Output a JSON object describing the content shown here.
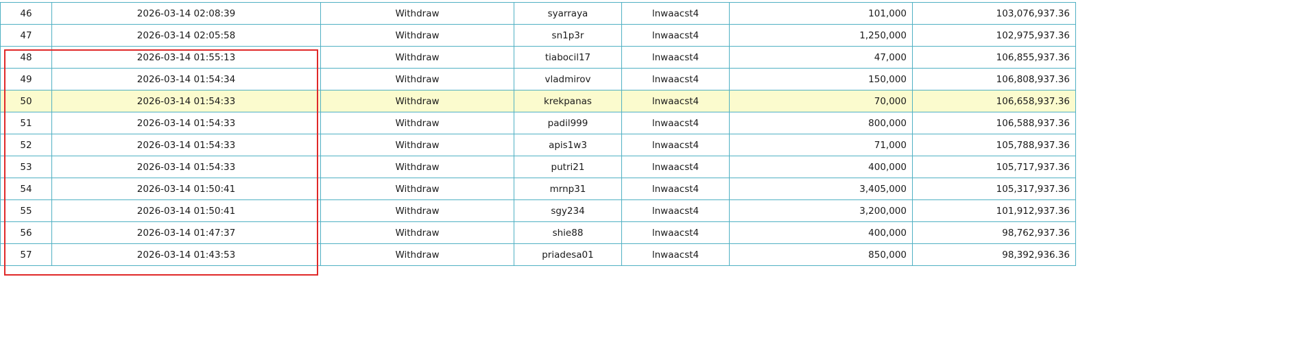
{
  "colors": {
    "grid_border": "#4fb0c3",
    "highlight_row": "#fbfbce",
    "selection_box": "#e02828"
  },
  "highlighted_row_no": "50",
  "rows": [
    {
      "no": "46",
      "datetime": "2026-03-14 02:08:39",
      "type": "Withdraw",
      "username": "syarraya",
      "operator": "lnwaacst4",
      "amount": "101,000",
      "balance": "103,076,937.36"
    },
    {
      "no": "47",
      "datetime": "2026-03-14 02:05:58",
      "type": "Withdraw",
      "username": "sn1p3r",
      "operator": "lnwaacst4",
      "amount": "1,250,000",
      "balance": "102,975,937.36"
    },
    {
      "no": "48",
      "datetime": "2026-03-14 01:55:13",
      "type": "Withdraw",
      "username": "tiabocil17",
      "operator": "lnwaacst4",
      "amount": "47,000",
      "balance": "106,855,937.36"
    },
    {
      "no": "49",
      "datetime": "2026-03-14 01:54:34",
      "type": "Withdraw",
      "username": "vladmirov",
      "operator": "lnwaacst4",
      "amount": "150,000",
      "balance": "106,808,937.36"
    },
    {
      "no": "50",
      "datetime": "2026-03-14 01:54:33",
      "type": "Withdraw",
      "username": "krekpanas",
      "operator": "lnwaacst4",
      "amount": "70,000",
      "balance": "106,658,937.36"
    },
    {
      "no": "51",
      "datetime": "2026-03-14 01:54:33",
      "type": "Withdraw",
      "username": "padil999",
      "operator": "lnwaacst4",
      "amount": "800,000",
      "balance": "106,588,937.36"
    },
    {
      "no": "52",
      "datetime": "2026-03-14 01:54:33",
      "type": "Withdraw",
      "username": "apis1w3",
      "operator": "lnwaacst4",
      "amount": "71,000",
      "balance": "105,788,937.36"
    },
    {
      "no": "53",
      "datetime": "2026-03-14 01:54:33",
      "type": "Withdraw",
      "username": "putri21",
      "operator": "lnwaacst4",
      "amount": "400,000",
      "balance": "105,717,937.36"
    },
    {
      "no": "54",
      "datetime": "2026-03-14 01:50:41",
      "type": "Withdraw",
      "username": "mrnp31",
      "operator": "lnwaacst4",
      "amount": "3,405,000",
      "balance": "105,317,937.36"
    },
    {
      "no": "55",
      "datetime": "2026-03-14 01:50:41",
      "type": "Withdraw",
      "username": "sgy234",
      "operator": "lnwaacst4",
      "amount": "3,200,000",
      "balance": "101,912,937.36"
    },
    {
      "no": "56",
      "datetime": "2026-03-14 01:47:37",
      "type": "Withdraw",
      "username": "shie88",
      "operator": "lnwaacst4",
      "amount": "400,000",
      "balance": "98,762,937.36"
    },
    {
      "no": "57",
      "datetime": "2026-03-14 01:43:53",
      "type": "Withdraw",
      "username": "priadesa01",
      "operator": "lnwaacst4",
      "amount": "850,000",
      "balance": "98,392,936.36"
    }
  ]
}
